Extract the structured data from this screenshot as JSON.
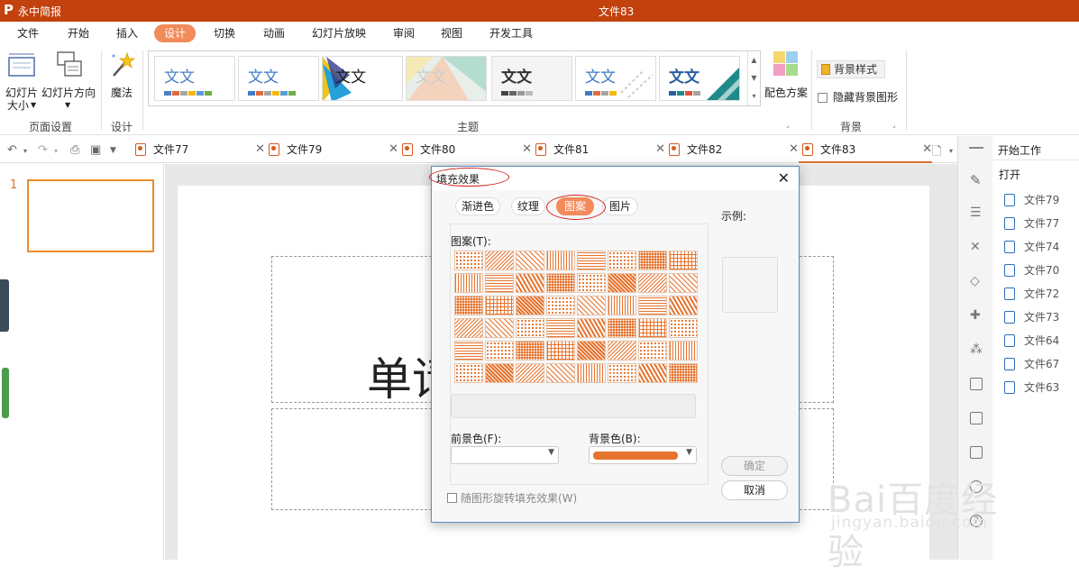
{
  "titlebar": {
    "app_name": "永中简报",
    "doc_title": "文件83"
  },
  "menu": {
    "items": [
      "文件",
      "开始",
      "插入",
      "设计",
      "切换",
      "动画",
      "幻灯片放映",
      "审阅",
      "视图",
      "开发工具"
    ],
    "active": "设计"
  },
  "ribbon": {
    "slide_size": "幻灯片大小",
    "slide_size_line1": "幻灯片",
    "slide_size_line2": "大小",
    "slide_orientation": "幻灯片方向",
    "magic": "魔法",
    "group_page_setup": "页面设置",
    "group_design": "设计",
    "group_theme": "主题",
    "color_scheme": "配色方案",
    "bg_style": "背景样式",
    "hide_bg": "隐藏背景图形",
    "group_background": "背景",
    "theme_sample_text": "文文"
  },
  "tabs": [
    {
      "label": "文件77"
    },
    {
      "label": "文件79"
    },
    {
      "label": "文件80"
    },
    {
      "label": "文件81"
    },
    {
      "label": "文件82"
    },
    {
      "label": "文件83"
    }
  ],
  "thumbnail": {
    "number": "1"
  },
  "slide": {
    "title_visible": "单请"
  },
  "right_pane": {
    "title": "开始工作",
    "open": "打开",
    "files": [
      "文件79",
      "文件77",
      "文件74",
      "文件70",
      "文件72",
      "文件73",
      "文件64",
      "文件67",
      "文件63"
    ]
  },
  "dialog": {
    "title": "填充效果",
    "tabs": [
      "渐进色",
      "纹理",
      "图案",
      "图片"
    ],
    "active_tab": "图案",
    "pattern_label": "图案(T):",
    "sample_label": "示例:",
    "fg_label": "前景色(F):",
    "bg_label": "背景色(B):",
    "fg_color": "#ffffff",
    "bg_color": "#e6732e",
    "rotate_label": "随图形旋转填充效果(W)",
    "ok": "确定",
    "cancel": "取消"
  },
  "watermark": {
    "main": "Bai百度经验",
    "sub": "jingyan.baidu.com"
  },
  "colors": {
    "accent": "#c2410c",
    "pattern_orange": "#e6732e",
    "tab_active": "#f28a5a"
  }
}
